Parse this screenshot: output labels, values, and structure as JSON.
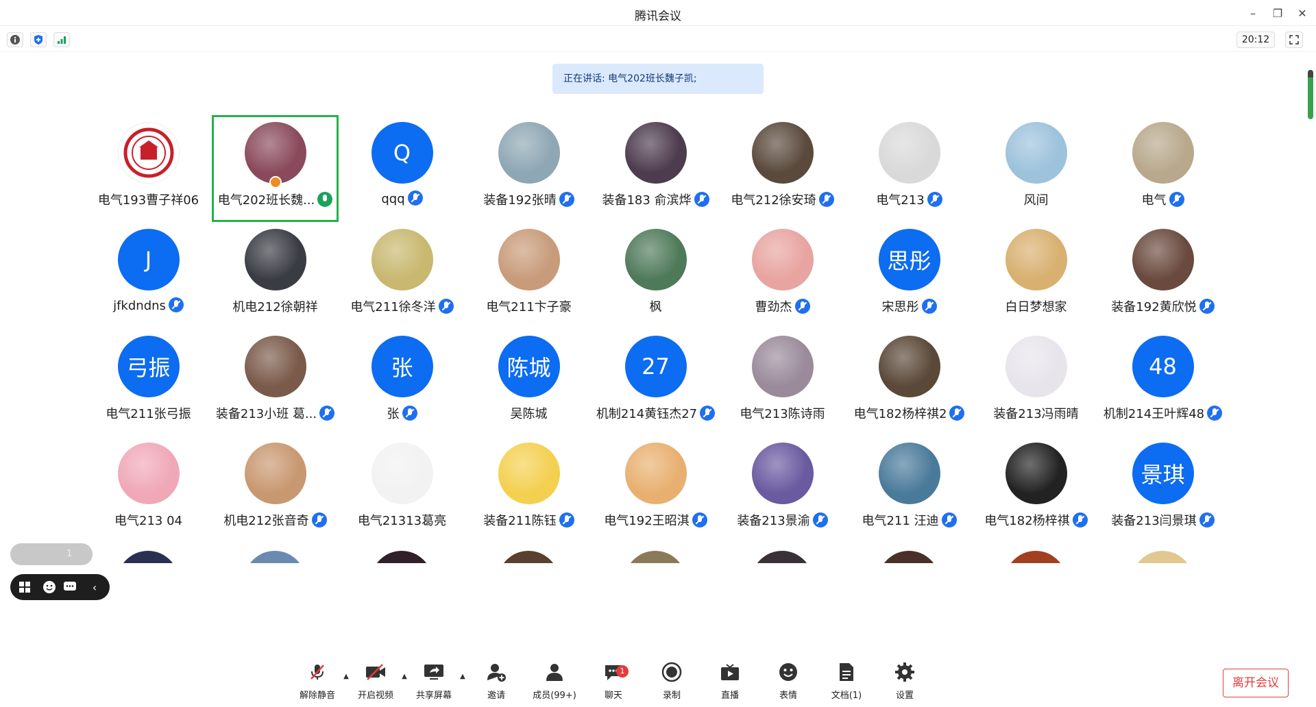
{
  "window": {
    "title": "腾讯会议"
  },
  "topbar": {
    "clock": "20:12"
  },
  "speaking_banner": "正在讲话: 电气202班长魏子凯;",
  "participants_row1": [
    {
      "name": "电气193曹子祥06",
      "mic": "none",
      "avatar": "logo",
      "color": "#ffffff"
    },
    {
      "name": "电气202班长魏...",
      "mic": "active",
      "avatar": "photo",
      "color": "#8a4a5c",
      "active": true
    },
    {
      "name": "qqq",
      "mic": "muted",
      "avatar": "letter",
      "letter": "Q"
    },
    {
      "name": "装备192张晴",
      "mic": "muted",
      "avatar": "photo",
      "color": "#8ea7b4"
    },
    {
      "name": "装备183 俞滨烨",
      "mic": "muted",
      "avatar": "photo",
      "color": "#4d3b4e"
    },
    {
      "name": "电气212徐安琦",
      "mic": "muted",
      "avatar": "photo",
      "color": "#5a4a3c"
    },
    {
      "name": "电气213",
      "mic": "muted",
      "avatar": "photo",
      "color": "#d9d9d9"
    },
    {
      "name": "风间",
      "mic": "none",
      "avatar": "photo",
      "color": "#9dc2dc"
    },
    {
      "name": "电气",
      "mic": "muted",
      "avatar": "photo",
      "color": "#b8a88c"
    }
  ],
  "participants_row2": [
    {
      "name": "jfkdndns",
      "mic": "muted",
      "avatar": "letter",
      "letter": "J"
    },
    {
      "name": "机电212徐朝祥",
      "mic": "none",
      "avatar": "photo",
      "color": "#3a3c44"
    },
    {
      "name": "电气211徐冬洋",
      "mic": "muted",
      "avatar": "photo",
      "color": "#c8b870"
    },
    {
      "name": "电气211卞子豪",
      "mic": "none",
      "avatar": "photo",
      "color": "#c89b7a"
    },
    {
      "name": "枫",
      "mic": "none",
      "avatar": "photo",
      "color": "#4f7a5a"
    },
    {
      "name": "曹劲杰",
      "mic": "muted",
      "avatar": "photo",
      "color": "#e8a4a0"
    },
    {
      "name": "宋思彤",
      "mic": "muted",
      "avatar": "letter",
      "letter": "思彤"
    },
    {
      "name": "白日梦想家",
      "mic": "none",
      "avatar": "photo",
      "color": "#d8b070"
    },
    {
      "name": "装备192黄欣悦",
      "mic": "muted",
      "avatar": "photo",
      "color": "#6a4a3e"
    }
  ],
  "participants_row3": [
    {
      "name": "电气211张弓振",
      "mic": "none",
      "avatar": "letter",
      "letter": "弓振"
    },
    {
      "name": "装备213小班 葛...",
      "mic": "muted",
      "avatar": "photo",
      "color": "#7a5a4a"
    },
    {
      "name": "张",
      "mic": "muted",
      "avatar": "letter",
      "letter": "张"
    },
    {
      "name": "吴陈城",
      "mic": "none",
      "avatar": "letter",
      "letter": "陈城"
    },
    {
      "name": "机制214黄钰杰27",
      "mic": "muted",
      "avatar": "letter",
      "letter": "27"
    },
    {
      "name": "电气213陈诗雨",
      "mic": "none",
      "avatar": "photo",
      "color": "#9a8a9a"
    },
    {
      "name": "电气182杨梓祺2",
      "mic": "muted",
      "avatar": "photo",
      "color": "#5a4838"
    },
    {
      "name": "装备213冯雨晴",
      "mic": "none",
      "avatar": "photo",
      "color": "#e8e4ec"
    },
    {
      "name": "机制214王叶辉48",
      "mic": "muted",
      "avatar": "letter",
      "letter": "48"
    }
  ],
  "participants_row4": [
    {
      "name": "电气213 04",
      "mic": "none",
      "avatar": "photo",
      "color": "#f0a8b8"
    },
    {
      "name": "机电212张音奇",
      "mic": "muted",
      "avatar": "photo",
      "color": "#c89870"
    },
    {
      "name": "电气21313葛亮",
      "mic": "none",
      "avatar": "photo",
      "color": "#f2f2f2"
    },
    {
      "name": "装备211陈钰",
      "mic": "muted",
      "avatar": "photo",
      "color": "#f4d050"
    },
    {
      "name": "电气192王昭淇",
      "mic": "muted",
      "avatar": "photo",
      "color": "#e8b070"
    },
    {
      "name": "装备213景渝",
      "mic": "muted",
      "avatar": "photo",
      "color": "#6a5aa0"
    },
    {
      "name": "电气211 汪迪",
      "mic": "muted",
      "avatar": "photo",
      "color": "#4a7a9a"
    },
    {
      "name": "电气182杨梓祺",
      "mic": "muted",
      "avatar": "photo",
      "color": "#222222"
    },
    {
      "name": "装备213闫景琪",
      "mic": "muted",
      "avatar": "letter",
      "letter": "景琪"
    }
  ],
  "row5_colors": [
    "#2a3050",
    "#6a8ab0",
    "#30202a",
    "#5a4030",
    "#8a7a5a",
    "#3a3038",
    "#4a3028",
    "#a04020",
    "#e0c890"
  ],
  "float_pill": {
    "count": "1"
  },
  "controls": {
    "unmute": "解除静音",
    "video": "开启视频",
    "share": "共享屏幕",
    "invite": "邀请",
    "members": "成员(99+)",
    "chat": "聊天",
    "chat_badge": "1",
    "record": "录制",
    "live": "直播",
    "emoji": "表情",
    "docs": "文档(1)",
    "settings": "设置",
    "leave": "离开会议"
  }
}
